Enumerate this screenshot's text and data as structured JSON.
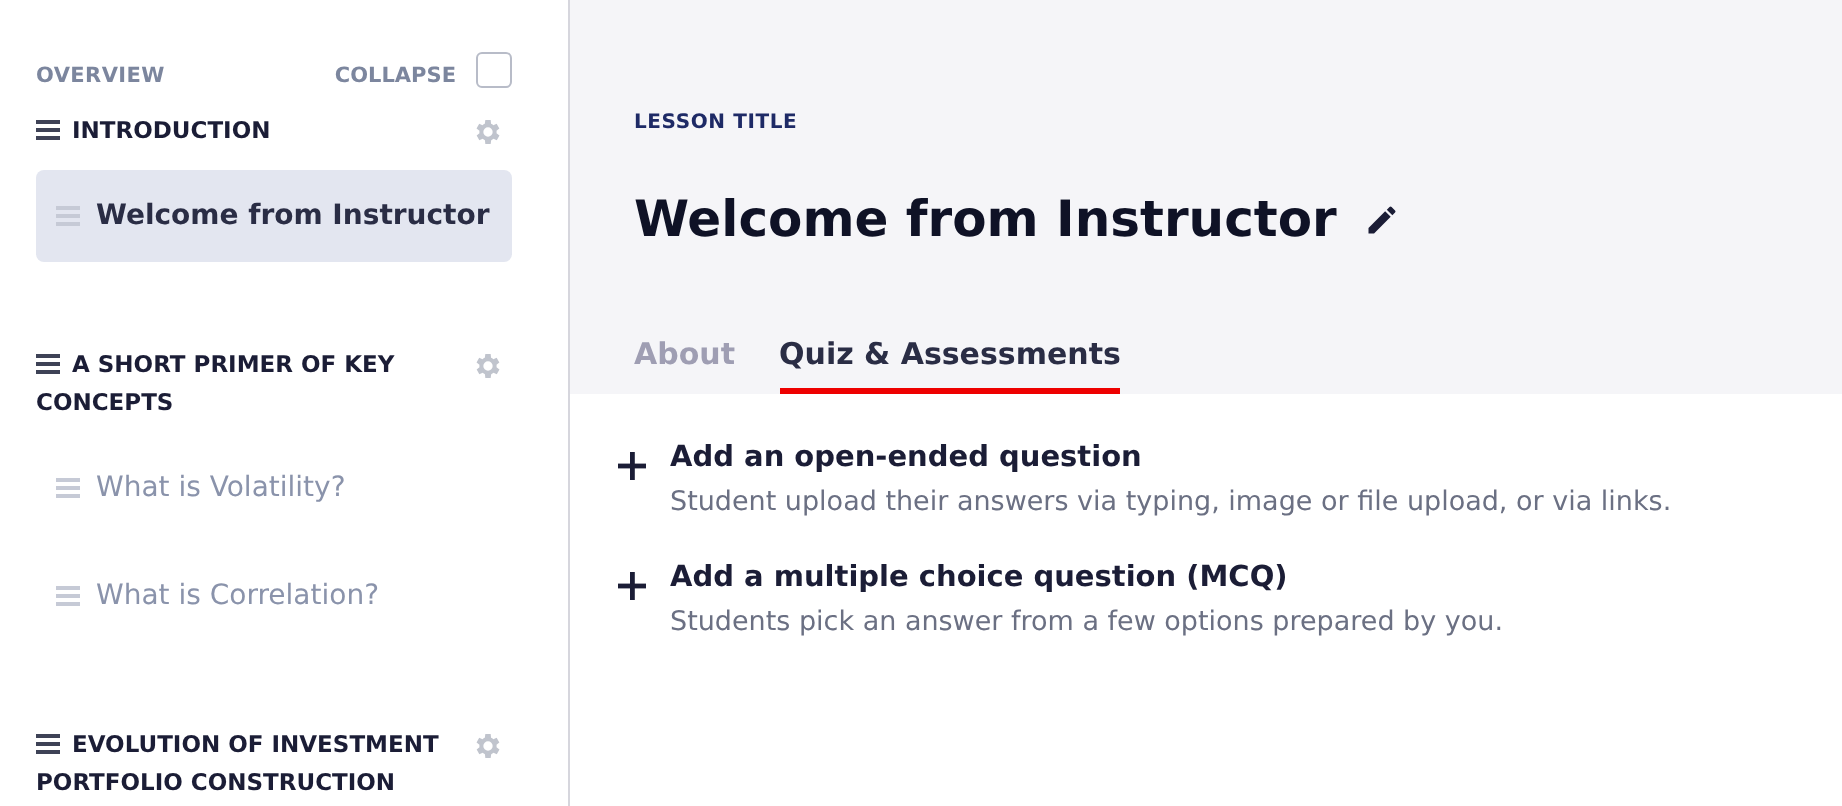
{
  "sidebar": {
    "overview_label": "OVERVIEW",
    "collapse": {
      "label": "COLLAPSE",
      "checked": false
    },
    "sections": [
      {
        "title": "INTRODUCTION",
        "lessons": [
          {
            "title": "Welcome from Instructor",
            "selected": true
          }
        ]
      },
      {
        "title": "A SHORT PRIMER OF KEY CONCEPTS",
        "lessons": [
          {
            "title": "What is Volatility?",
            "selected": false
          },
          {
            "title": "What is Correlation?",
            "selected": false
          }
        ]
      },
      {
        "title": "EVOLUTION OF INVESTMENT PORTFOLIO CONSTRUCTION"
      }
    ]
  },
  "main": {
    "label": "LESSON TITLE",
    "title": "Welcome from Instructor",
    "tabs": [
      {
        "label": "About",
        "selected": false
      },
      {
        "label": "Quiz & Assessments",
        "selected": true
      }
    ],
    "actions": [
      {
        "title": "Add an open-ended question",
        "description": "Student upload their answers via typing, image or file upload, or via links."
      },
      {
        "title": "Add a multiple choice question (MCQ)",
        "description": "Students pick an answer from a few options prepared by you."
      }
    ]
  }
}
